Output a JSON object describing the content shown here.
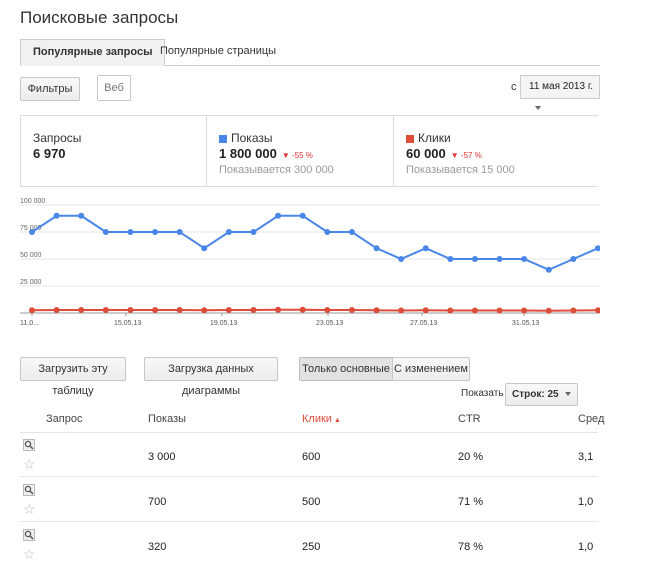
{
  "page_title": "Поисковые запросы",
  "tabs": [
    {
      "label": "Популярные запросы",
      "active": true
    },
    {
      "label": "Популярные страницы",
      "active": false
    }
  ],
  "filters": {
    "filters_label": "Фильтры",
    "web_label": "Веб"
  },
  "date": {
    "prefix": "с",
    "value": "11 мая 2013 г."
  },
  "metrics": {
    "queries": {
      "label": "Запросы",
      "value": "6 970"
    },
    "impressions": {
      "label": "Показы",
      "value": "1 800 000",
      "change": "-55 %",
      "sub": "Показывается 300 000",
      "color": "#4a86e8"
    },
    "clicks": {
      "label": "Клики",
      "value": "60 000",
      "change": "-57 %",
      "sub": "Показывается 15 000",
      "color": "#dd4b39"
    }
  },
  "chart_data": {
    "type": "line",
    "y_ticks": [
      "100 000",
      "75 000",
      "50 000",
      "25 000"
    ],
    "x_ticks": [
      "11.0...",
      "15.05.13",
      "19.05.13",
      "23.05.13",
      "27.05.13",
      "31.05.13"
    ],
    "ylim": [
      0,
      100000
    ],
    "series": [
      {
        "name": "Показы",
        "color": "#4a86e8",
        "values": [
          75000,
          90000,
          90000,
          75000,
          75000,
          75000,
          75000,
          60000,
          75000,
          75000,
          90000,
          90000,
          75000,
          75000,
          60000,
          50000,
          60000,
          50000,
          50000,
          50000,
          50000,
          40000,
          50000,
          60000
        ]
      },
      {
        "name": "Клики",
        "color": "#dd4b39",
        "values": [
          2500,
          2800,
          2800,
          2800,
          2800,
          2800,
          2800,
          2600,
          2800,
          2800,
          3000,
          3000,
          2800,
          2800,
          2500,
          2300,
          2500,
          2300,
          2300,
          2300,
          2300,
          2100,
          2300,
          2500
        ]
      }
    ]
  },
  "actions": {
    "download_table": "Загрузить эту таблицу",
    "download_chart": "Загрузка данных диаграммы",
    "only_main": "Только основные",
    "with_changes": "С изменением"
  },
  "pager": {
    "show_label": "Показать",
    "rows_label": "Строк: 25"
  },
  "table": {
    "headers": {
      "query": "Запрос",
      "impressions": "Показы",
      "clicks": "Клики",
      "ctr": "CTR",
      "avg": "Сред"
    },
    "rows": [
      {
        "impressions": "3 000",
        "clicks": "600",
        "ctr": "20 %",
        "avg": "3,1"
      },
      {
        "impressions": "700",
        "clicks": "500",
        "ctr": "71 %",
        "avg": "1,0"
      },
      {
        "impressions": "320",
        "clicks": "250",
        "ctr": "78 %",
        "avg": "1,0"
      }
    ]
  }
}
